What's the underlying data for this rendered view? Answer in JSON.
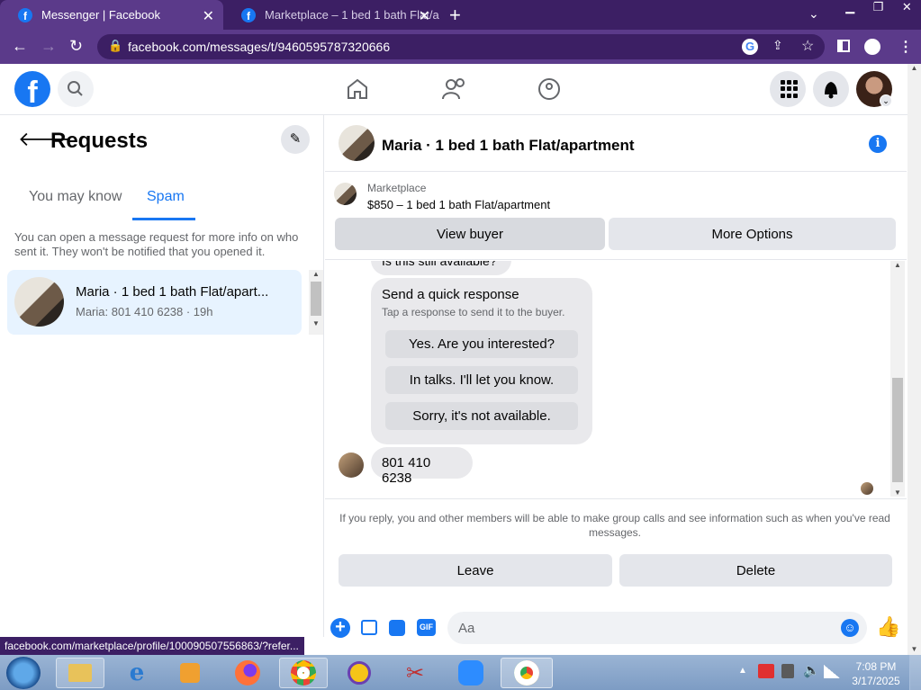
{
  "browser": {
    "tabs": [
      {
        "title": "Messenger | Facebook",
        "active": true
      },
      {
        "title": "Marketplace – 1 bed 1 bath Flat/a",
        "active": false
      }
    ],
    "url": "facebook.com/messages/t/9460595787320666",
    "status_url": "facebook.com/marketplace/profile/100090507556863/?refer..."
  },
  "left": {
    "title": "Requests",
    "tabs": [
      "You may know",
      "Spam"
    ],
    "active_tab": "Spam",
    "info": "You can open a message request for more info on who sent it. They won't be notified that you opened it.",
    "conversation": {
      "name": "Maria · 1 bed 1 bath Flat/apart...",
      "preview": "Maria: 801 410 6238 · 19h"
    }
  },
  "chat": {
    "header_title": "Maria · 1 bed 1 bath Flat/apartment",
    "listing_source": "Marketplace",
    "listing_title": "$850 – 1 bed 1 bath Flat/apartment",
    "view_buyer": "View buyer",
    "more_options": "More Options",
    "cut_message": "Is this still available?",
    "quick_title": "Send a quick response",
    "quick_sub": "Tap a response to send it to the buyer.",
    "quick_responses": [
      "Yes. Are you interested?",
      "In talks. I'll let you know.",
      "Sorry, it's not available."
    ],
    "phone_msg": "801 410 6238",
    "reply_notice": "If you reply, you and other members will be able to make group calls and see information such as when you've read messages.",
    "leave": "Leave",
    "delete": "Delete",
    "composer_placeholder": "Aa"
  },
  "taskbar": {
    "time": "7:08 PM",
    "date": "3/17/2025"
  },
  "colors": {
    "fb_blue": "#1877f2",
    "chrome_purple": "#5b3a8a",
    "chrome_dark": "#3c1f64"
  }
}
